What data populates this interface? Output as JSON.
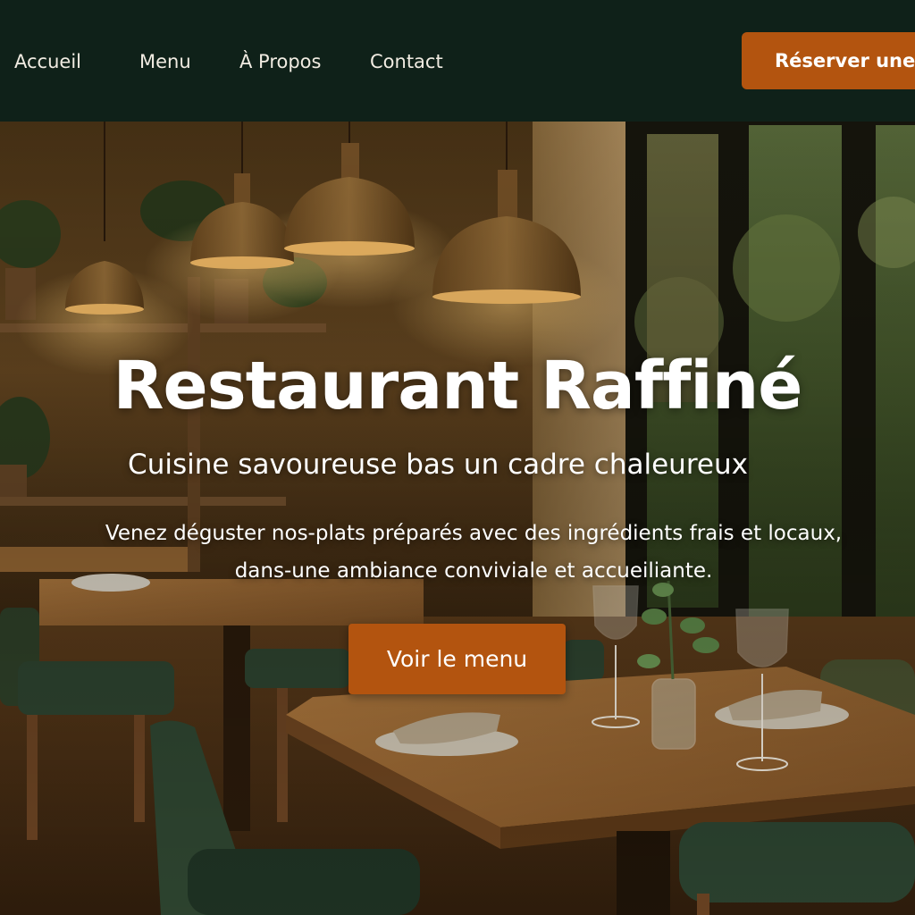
{
  "nav": {
    "links": [
      {
        "label": "Accueil"
      },
      {
        "label": "Menu"
      },
      {
        "label": "À Propos"
      },
      {
        "label": "Contact"
      }
    ],
    "reserve_label": "Réserver une t"
  },
  "hero": {
    "title": "Restaurant Raffiné",
    "subtitle": "Cuisine savoureuse bas un cadre chaleureux",
    "description_line1": "Venez déguster nos-plats préparés avec des ingrédients frais et locaux,",
    "description_line2": "dans-une ambiance conviviale et accueiliante.",
    "cta_label": "Voir le menu"
  },
  "colors": {
    "nav_background": "#0f2119",
    "accent": "#b3540f",
    "text_light": "#f1ece2"
  }
}
